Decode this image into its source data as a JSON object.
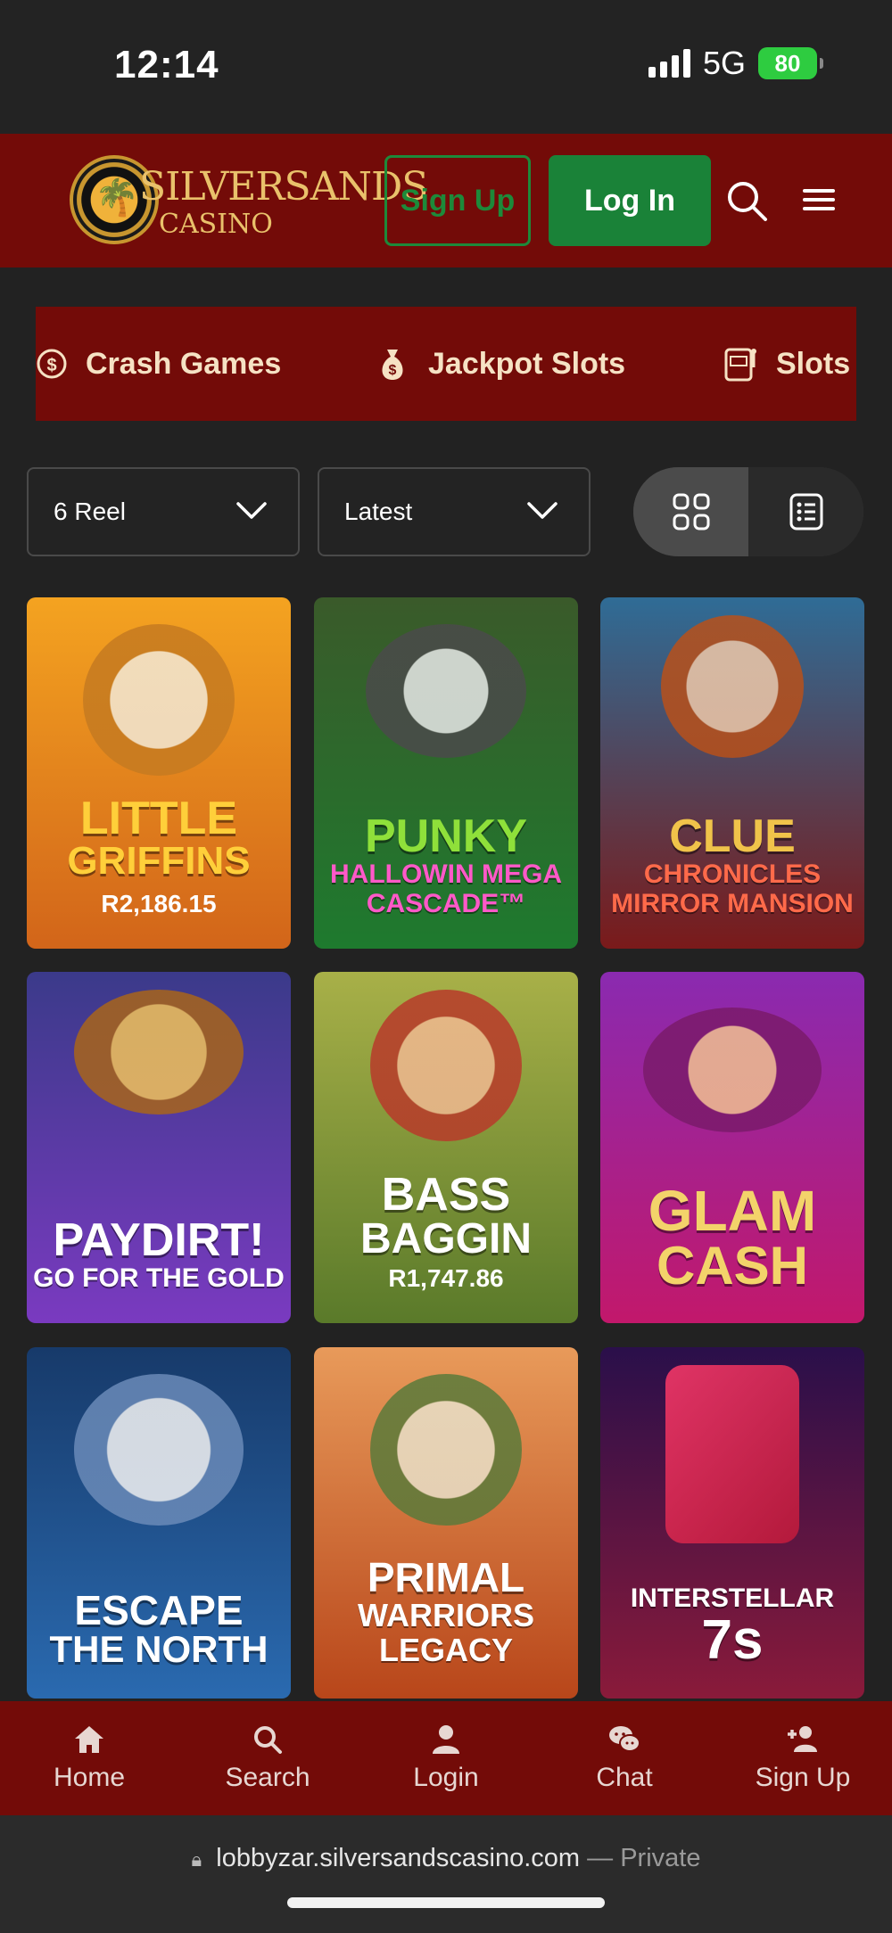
{
  "status_bar": {
    "time": "12:14",
    "network": "5G",
    "battery": "80"
  },
  "header": {
    "logo_text": "SILVERSANDS",
    "logo_sub": "CASINO",
    "signup_label": "Sign Up",
    "login_label": "Log In"
  },
  "categories": [
    {
      "label": "Crash Games",
      "icon": "coin-arrow-icon"
    },
    {
      "label": "Jackpot Slots",
      "icon": "money-bag-icon"
    },
    {
      "label": "Slots",
      "icon": "slot-machine-icon"
    }
  ],
  "filters": {
    "reel_select": "6 Reel",
    "sort_select": "Latest",
    "view_mode": "grid"
  },
  "games": [
    {
      "title": "LITTLE",
      "subtitle": "GRIFFINS",
      "jackpot": "R2,186.15",
      "colors": [
        "#f4a320",
        "#d2651a"
      ],
      "title_color": "#ffcf3a"
    },
    {
      "title": "PUNKY",
      "subtitle": "HALLOWIN MEGA CASCADE™",
      "jackpot": "",
      "colors": [
        "#3a5a2a",
        "#1e7a2e"
      ],
      "title_color": "#8fe03a"
    },
    {
      "title": "CLUE",
      "subtitle": "CHRONICLES MIRROR MANSION",
      "jackpot": "",
      "colors": [
        "#2f6c96",
        "#7a1a1a"
      ],
      "title_color": "#f0c34a"
    },
    {
      "title": "PAYDIRT!",
      "subtitle": "GO FOR THE GOLD",
      "jackpot": "",
      "colors": [
        "#3b3a8a",
        "#7a3ac0"
      ],
      "title_color": "#ffffff"
    },
    {
      "title": "BASS",
      "subtitle": "BAGGIN",
      "jackpot": "R1,747.86",
      "colors": [
        "#a8b048",
        "#5a7a2a"
      ],
      "title_color": "#ffffff"
    },
    {
      "title": "GLAM",
      "subtitle": "CASH",
      "jackpot": "",
      "colors": [
        "#8a2ab0",
        "#c2186b"
      ],
      "title_color": "#f3d36a"
    },
    {
      "title": "ESCAPE",
      "subtitle": "THE NORTH",
      "jackpot": "",
      "colors": [
        "#173a6a",
        "#2a6ab0"
      ],
      "title_color": "#ffffff"
    },
    {
      "title": "PRIMAL",
      "subtitle": "WARRIORS LEGACY",
      "jackpot": "",
      "colors": [
        "#e89a5a",
        "#b8461a"
      ],
      "title_color": "#ffffff"
    },
    {
      "title": "INTERSTELLAR",
      "subtitle": "7s",
      "jackpot": "",
      "colors": [
        "#2a0f4a",
        "#8a1a3a"
      ],
      "title_color": "#ffffff"
    }
  ],
  "bottom_nav": [
    {
      "label": "Home",
      "icon": "home-icon"
    },
    {
      "label": "Search",
      "icon": "search-icon"
    },
    {
      "label": "Login",
      "icon": "user-icon"
    },
    {
      "label": "Chat",
      "icon": "chat-icon"
    },
    {
      "label": "Sign Up",
      "icon": "add-user-icon"
    }
  ],
  "browser": {
    "url": "lobbyzar.silversandscasino.com",
    "separator": "—",
    "mode": "Private"
  }
}
